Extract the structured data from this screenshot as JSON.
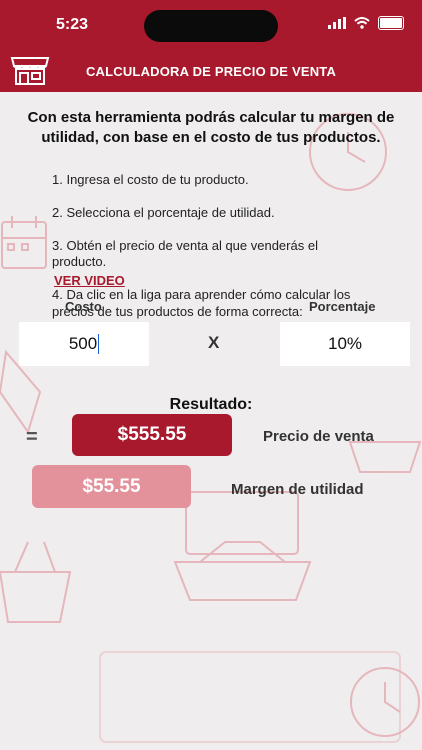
{
  "status_bar": {
    "time": "5:23"
  },
  "header": {
    "title": "CALCULADORA DE PRECIO DE VENTA"
  },
  "intro": "Con esta herramienta podrás calcular tu margen de utilidad, con base en el costo de tus productos.",
  "steps": [
    "1. Ingresa el costo de tu producto.",
    "2. Selecciona el porcentaje de utilidad.",
    "3. Obtén el precio de venta al que venderás el producto.",
    "4. Da clic en la liga para aprender cómo calcular los precios de tus productos de forma correcta:"
  ],
  "video_link": "VER VIDEO",
  "cost": {
    "label": "Costo",
    "value": "500"
  },
  "operator": "X",
  "percent": {
    "label": "Porcentaje",
    "value": "10%"
  },
  "result": {
    "title": "Resultado:",
    "equals": "=",
    "sale_price": "$555.55",
    "sale_price_label": "Precio de venta",
    "margin": "$55.55",
    "margin_label": "Margen de utilidad"
  },
  "colors": {
    "brand": "#a8192d",
    "margin_pill": "#e3919a",
    "background": "#efeded"
  },
  "icons": [
    "store-icon",
    "wifi-icon",
    "signal-icon",
    "battery-icon"
  ]
}
